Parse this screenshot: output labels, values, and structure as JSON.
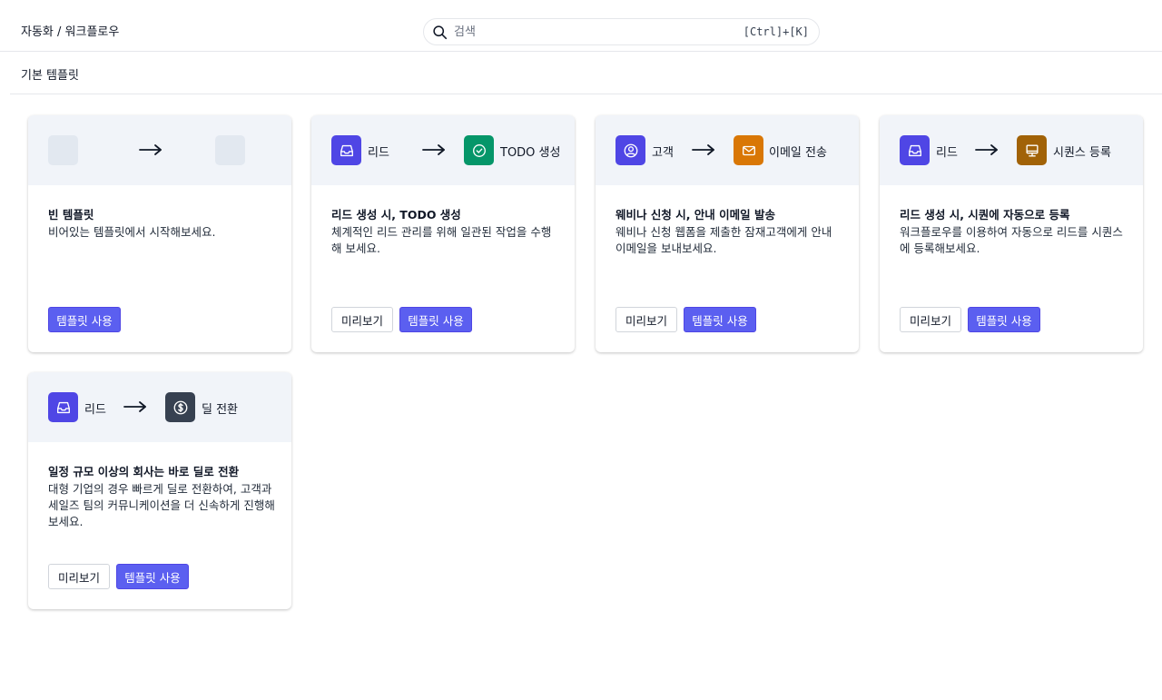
{
  "header": {
    "breadcrumb": "자동화 / 워크플로우",
    "search_placeholder": "검색",
    "search_shortcut": "[Ctrl]+[K]"
  },
  "section": {
    "title": "기본 템플릿"
  },
  "buttons": {
    "preview": "미리보기",
    "use": "템플릿 사용"
  },
  "colors": {
    "accent": "#5b5ff0",
    "lead": "#4f46e5",
    "todo": "#059669",
    "email": "#d97706",
    "sequence": "#a16207",
    "deal": "#374151",
    "placeholder": "#e2e8f0"
  },
  "cards": [
    {
      "title": "빈 템플릿",
      "description": "비어있는 템플릿에서 시작해보세요.",
      "from": {
        "icon": "empty-slot",
        "label": ""
      },
      "to": {
        "icon": "empty-slot",
        "label": ""
      }
    },
    {
      "title": "리드 생성 시, TODO 생성",
      "description": "체계적인 리드 관리를 위해 일관된 작업을 수행해 보세요.",
      "from": {
        "icon": "inbox-icon",
        "label": "리드"
      },
      "to": {
        "icon": "check-circle-icon",
        "label": "TODO 생성"
      }
    },
    {
      "title": "웨비나 신청 시, 안내 이메일 발송",
      "description": "웨비나 신청 웹폼을 제출한 잠재고객에게 안내 이메일을 보내보세요.",
      "from": {
        "icon": "user-circle-icon",
        "label": "고객"
      },
      "to": {
        "icon": "mail-icon",
        "label": "이메일 전송"
      }
    },
    {
      "title": "리드 생성 시, 시퀀에 자동으로 등록",
      "description": "워크플로우를 이용하여 자동으로 리드를 시퀀스에 등록해보세요.",
      "from": {
        "icon": "inbox-icon",
        "label": "리드"
      },
      "to": {
        "icon": "monitor-icon",
        "label": "시퀀스 등록"
      }
    },
    {
      "title": "일정 규모 이상의 회사는 바로 딜로 전환",
      "description": "대형 기업의 경우 빠르게 딜로 전환하여, 고객과 세일즈 팀의 커뮤니케이션을 더 신속하게 진행해보세요.",
      "from": {
        "icon": "inbox-icon",
        "label": "리드"
      },
      "to": {
        "icon": "dollar-circle-icon",
        "label": "딜 전환"
      }
    }
  ]
}
